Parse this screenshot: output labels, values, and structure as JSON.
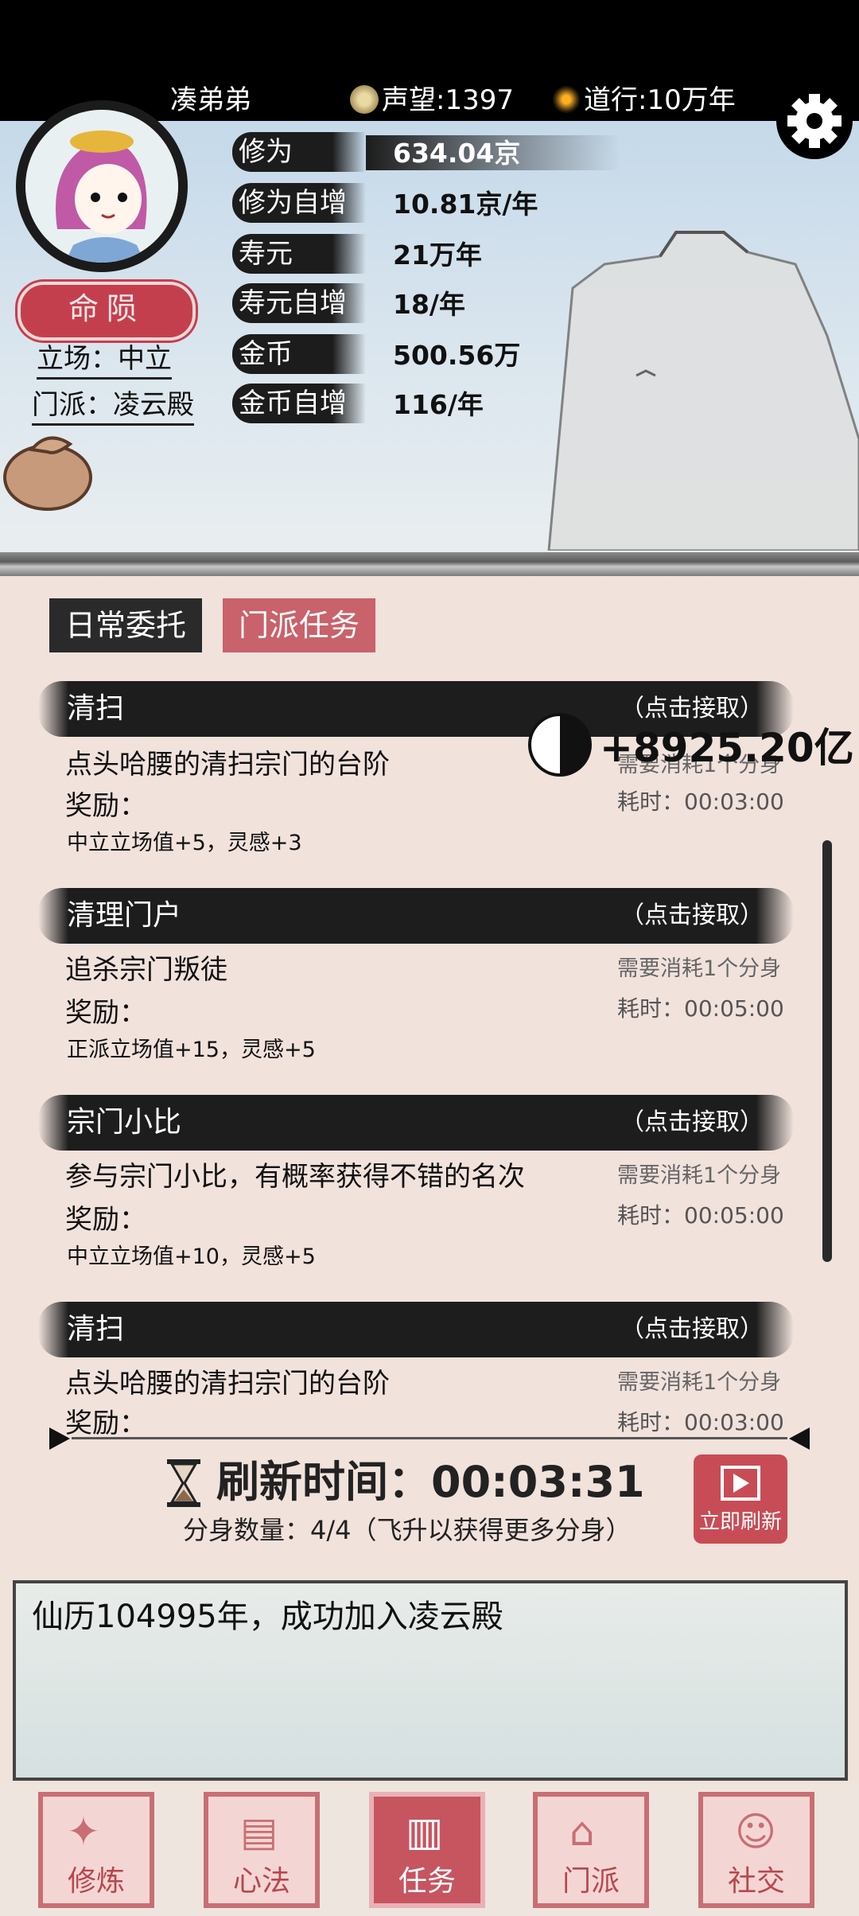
{
  "header": {
    "player_name": "凑弟弟",
    "reputation": "声望:1397",
    "dao": "道行:10万年",
    "settings_icon": "gear-icon"
  },
  "profile": {
    "fate_button": "命陨",
    "stance": "立场：中立",
    "sect": "门派：凌云殿"
  },
  "stats": [
    {
      "label": "修为",
      "value": "634.04京"
    },
    {
      "label": "修为自增",
      "value": "10.81京/年"
    },
    {
      "label": "寿元",
      "value": "21万年"
    },
    {
      "label": "寿元自增",
      "value": "18/年"
    },
    {
      "label": "金币",
      "value": "500.56万"
    },
    {
      "label": "金币自增",
      "value": "116/年"
    }
  ],
  "tabs": [
    {
      "label": "日常委托",
      "active": true
    },
    {
      "label": "门派任务",
      "active": false
    }
  ],
  "tasks": [
    {
      "title": "清扫",
      "action": "（点击接取）",
      "desc": "点头哈腰的清扫宗门的台阶",
      "reward_label": "奖励：",
      "reward": "中立立场值+5，灵感+3",
      "requirement": "需要消耗1个分身",
      "duration": "耗时：00:03:00"
    },
    {
      "title": "清理门户",
      "action": "（点击接取）",
      "desc": "追杀宗门叛徒",
      "reward_label": "奖励：",
      "reward": "正派立场值+15，灵感+5",
      "requirement": "需要消耗1个分身",
      "duration": "耗时：00:05:00"
    },
    {
      "title": "宗门小比",
      "action": "（点击接取）",
      "desc": "参与宗门小比，有概率获得不错的名次",
      "reward_label": "奖励：",
      "reward": "中立立场值+10，灵感+5",
      "requirement": "需要消耗1个分身",
      "duration": "耗时：00:05:00"
    },
    {
      "title": "清扫",
      "action": "（点击接取）",
      "desc": "点头哈腰的清扫宗门的台阶",
      "reward_label": "奖励：",
      "requirement": "需要消耗1个分身",
      "duration": "耗时：00:03:00"
    }
  ],
  "popup": "+8925.20亿",
  "refresh": {
    "title": "刷新时间：00:03:31",
    "clones": "分身数量：4/4（飞升以获得更多分身）",
    "button": "立即刷新"
  },
  "log": {
    "message": "仙历104995年，成功加入凌云殿"
  },
  "nav": [
    {
      "label": "修炼",
      "icon": "cultivate-icon"
    },
    {
      "label": "心法",
      "icon": "scroll-icon"
    },
    {
      "label": "任务",
      "icon": "task-icon",
      "active": true
    },
    {
      "label": "门派",
      "icon": "sect-icon"
    },
    {
      "label": "社交",
      "icon": "social-icon"
    }
  ],
  "colors": {
    "accent_red": "#c43f4e",
    "ink": "#1d1d1d",
    "paper": "#f1e2dc"
  }
}
